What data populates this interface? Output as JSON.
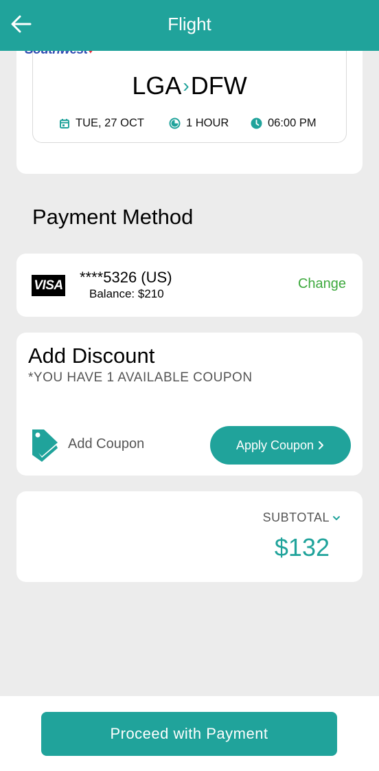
{
  "header": {
    "title": "Flight",
    "back_icon": "arrow-left-icon"
  },
  "flight": {
    "airline": "Southwest",
    "origin": "LGA",
    "destination": "DFW",
    "route_separator": "›",
    "date": "TUE, 27 OCT",
    "duration": "1 HOUR",
    "time": "06:00 PM"
  },
  "payment": {
    "section_title": "Payment Method",
    "card_brand": "VISA",
    "card_number": "****5326 (US)",
    "balance": "Balance: $210",
    "change_label": "Change"
  },
  "discount": {
    "title": "Add Discount",
    "subtitle": "*YOU HAVE 1 AVAILABLE COUPON",
    "add_coupon_label": "Add Coupon",
    "apply_label": "Apply Coupon"
  },
  "subtotal": {
    "label": "SUBTOTAL",
    "amount": "$132"
  },
  "footer": {
    "proceed_label": "Proceed with Payment"
  },
  "colors": {
    "accent": "#20a39b",
    "change": "#3ca83c",
    "background": "#ececec"
  }
}
